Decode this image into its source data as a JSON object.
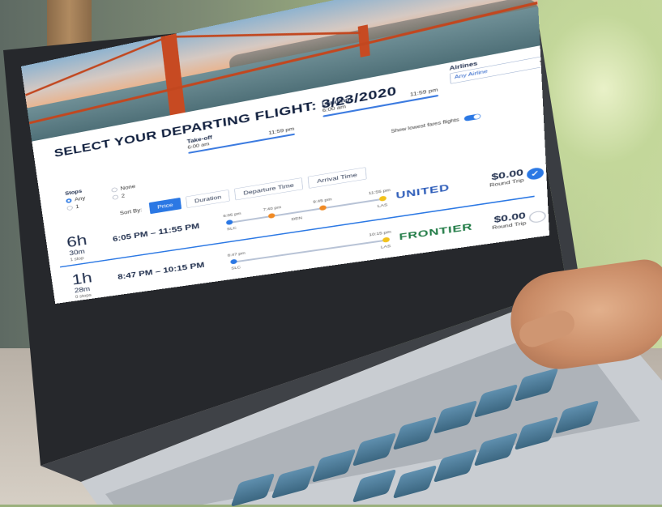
{
  "page": {
    "title": "SELECT YOUR DEPARTING FLIGHT: 3/23/2020"
  },
  "filters": {
    "takeoff": {
      "label": "Take-off",
      "start": "6:00 am",
      "end": "11:59 pm"
    },
    "landing": {
      "label": "Landing",
      "start": "6:00 am",
      "end": "11:59 pm"
    },
    "airlines": {
      "label": "Airlines",
      "selected": "Any Airline",
      "chevron": "chevron-down-icon"
    },
    "stops": {
      "label": "Stops",
      "options": [
        "Any",
        "1"
      ],
      "selected": "Any"
    },
    "fare_options": [
      "None",
      "2"
    ],
    "toggle_label": "Show lowest fares flights"
  },
  "sort": {
    "label": "Sort By:",
    "options": [
      "Price",
      "Duration",
      "Departure Time",
      "Arrival Time"
    ],
    "active": "Price"
  },
  "flights": [
    {
      "duration_hours": "6h",
      "duration_minutes": "30m",
      "stops": "1 stop",
      "times": "6:05 PM – 11:55 PM",
      "timeline_labels": [
        "6:05 pm",
        "7:40 pm",
        "9:45 pm",
        "11:55 pm"
      ],
      "timeline_codes": [
        "SLC",
        "DEN",
        "LAS"
      ],
      "carrier": "UNITED",
      "price": "$0.00",
      "price_note": "Round Trip",
      "selected": true
    },
    {
      "duration_hours": "1h",
      "duration_minutes": "28m",
      "stops": "0 stops",
      "times": "8:47 PM – 10:15 PM",
      "timeline_labels": [
        "8:47 pm",
        "10:15 pm"
      ],
      "timeline_codes": [
        "SLC",
        "LAS"
      ],
      "carrier": "FRONTIER",
      "price": "$0.00",
      "price_note": "Round Trip",
      "selected": false
    }
  ],
  "colors": {
    "accent": "#2b78e4",
    "title": "#0f1e3d",
    "stop_orange": "#f08a24",
    "stop_yellow": "#f2c21b",
    "united": "#2a5ab8",
    "frontier": "#1f7a44"
  }
}
